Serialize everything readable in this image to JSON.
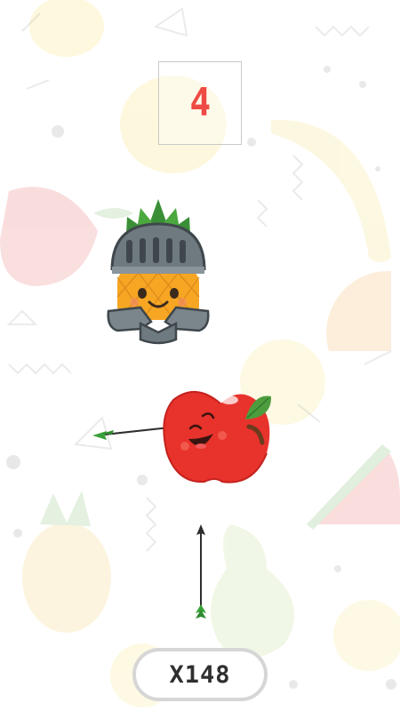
{
  "game": {
    "arrows_remaining": "4",
    "multiplier": "X148"
  },
  "sprites": {
    "boss": "pineapple-knight",
    "target": "apple",
    "stuck_arrow": "arrow",
    "player_arrow": "arrow"
  },
  "colors": {
    "score": "#ef4b45",
    "apple": "#e8322c",
    "leaf": "#3f8f3a",
    "arrow_fletch": "#3aa13a",
    "pill_border": "#d6d6d6",
    "multiplier_text": "#2f2f2f"
  }
}
